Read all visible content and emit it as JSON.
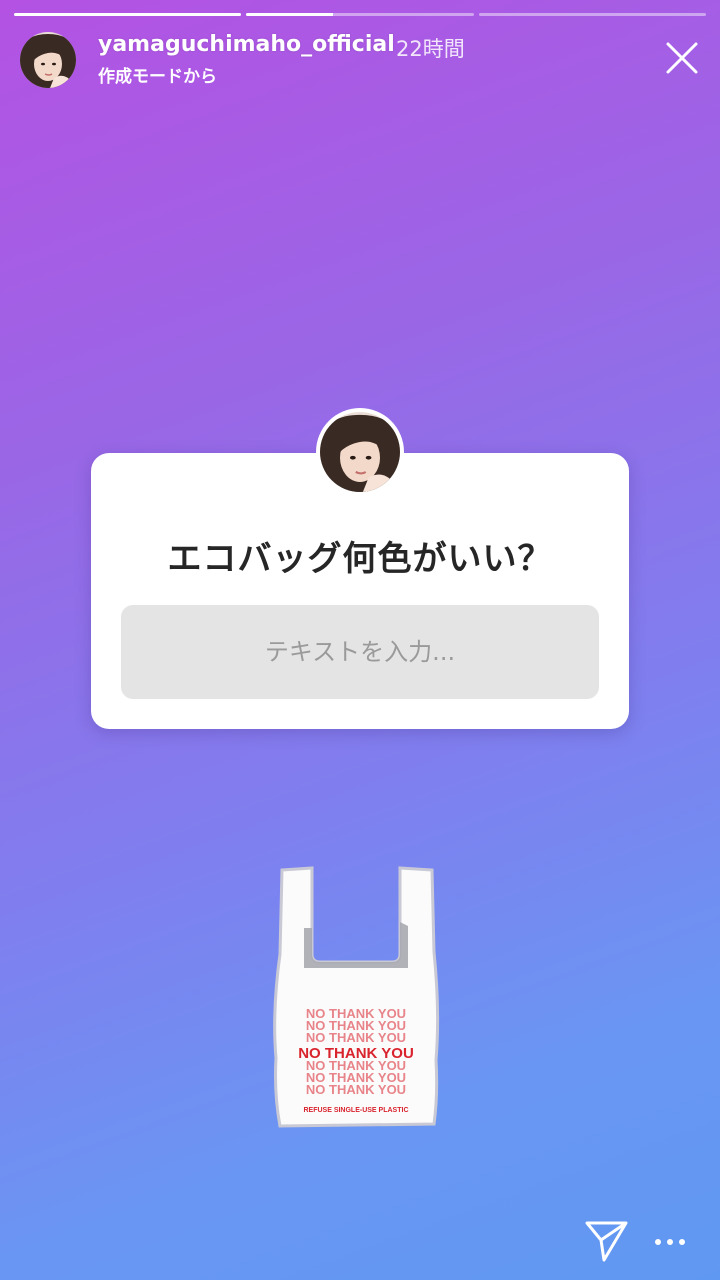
{
  "story": {
    "progress": [
      1.0,
      0.38,
      0.0
    ]
  },
  "header": {
    "username": "yamaguchimaho_official",
    "time": "22時間",
    "subtitle": "作成モードから",
    "avatar_icon": "user-avatar",
    "close_icon": "close-icon"
  },
  "question_sticker": {
    "question": "エコバッグ何色がいい？",
    "input_placeholder": "テキストを入力...",
    "input_value": "",
    "avatar_icon": "user-avatar"
  },
  "bag_sticker": {
    "icon": "plastic-bag-sticker",
    "lines": [
      "NO THANK YOU",
      "NO THANK YOU",
      "NO THANK YOU",
      "NO THANK YOU",
      "NO THANK YOU",
      "NO THANK YOU",
      "NO THANK YOU"
    ],
    "footer_text": "REFUSE SINGLE-USE PLASTIC",
    "text_color": "#d9232d"
  },
  "footer": {
    "send_icon": "paper-plane-icon",
    "more_icon": "more-dots-icon"
  },
  "colors": {
    "gradient_top": "#b452e3",
    "gradient_bottom": "#5f98f2",
    "card_bg": "#ffffff",
    "input_bg": "#e4e4e4"
  }
}
